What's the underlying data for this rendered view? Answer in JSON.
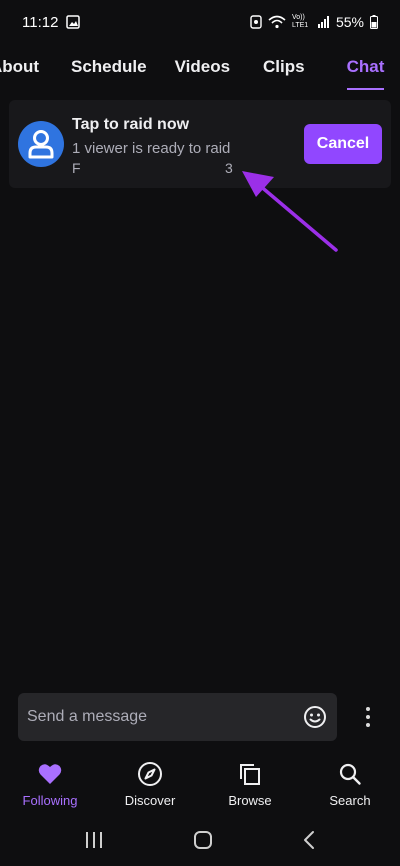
{
  "status_bar": {
    "time": "11:12",
    "battery": "55%",
    "network": "Vo)) LTE1"
  },
  "tabs": [
    {
      "label": "About",
      "active": false
    },
    {
      "label": "Schedule",
      "active": false
    },
    {
      "label": "Videos",
      "active": false
    },
    {
      "label": "Clips",
      "active": false
    },
    {
      "label": "Chat",
      "active": true
    }
  ],
  "raid": {
    "title": "Tap to raid now",
    "subtitle": "1 viewer is ready to raid",
    "initial": "F",
    "count": "3",
    "cancel_label": "Cancel"
  },
  "chat": {
    "placeholder": "Send a message"
  },
  "bottom_nav": [
    {
      "label": "Following",
      "icon": "heart-icon",
      "active": true
    },
    {
      "label": "Discover",
      "icon": "compass-icon",
      "active": false
    },
    {
      "label": "Browse",
      "icon": "browse-icon",
      "active": false
    },
    {
      "label": "Search",
      "icon": "search-icon",
      "active": false
    }
  ],
  "colors": {
    "background": "#0e0e10",
    "accent": "#9147ff",
    "accent_text": "#a970ff",
    "card": "#18181b",
    "avatar": "#2f74e0"
  }
}
